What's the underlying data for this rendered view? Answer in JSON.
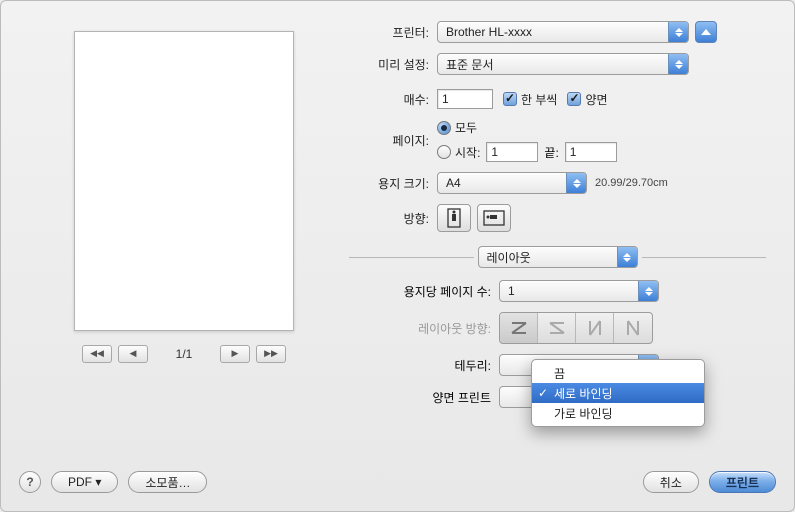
{
  "labels": {
    "printer": "프린터:",
    "preset": "미리 설정:",
    "copies": "매수:",
    "collated": "한 부씩",
    "twoSided": "양면",
    "pages": "페이지:",
    "pagesAll": "모두",
    "pagesFrom": "시작:",
    "pagesTo": "끝:",
    "paperSize": "용지 크기:",
    "orientation": "방향:",
    "section": "레이아웃",
    "pagesPerSheet": "용지당 페이지 수:",
    "layoutDirection": "레이아웃 방향:",
    "border": "테두리:",
    "duplexPrint": "양면 프린트"
  },
  "values": {
    "printer": "Brother HL-xxxx",
    "preset": "표준 문서",
    "copies": "1",
    "fromPage": "1",
    "toPage": "1",
    "paperSize": "A4",
    "paperDim": "20.99/29.70cm",
    "pagesPerSheet": "1",
    "pageIndicator": "1/1"
  },
  "popup": {
    "off": "끔",
    "long": "세로 바인딩",
    "short": "가로 바인딩"
  },
  "buttons": {
    "help": "?",
    "pdf": "PDF ▾",
    "supplies": "소모품…",
    "cancel": "취소",
    "print": "프린트"
  },
  "navGlyphs": {
    "first": "◀◀",
    "prev": "◀",
    "next": "▶",
    "last": "▶▶"
  }
}
